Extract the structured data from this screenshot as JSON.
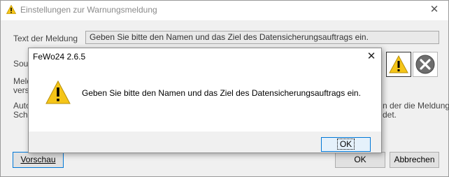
{
  "background_window": {
    "title": "Einstellungen zur Warnungsmeldung",
    "close_glyph": "✕",
    "message_label": "Text der Meldung",
    "message_value": "Geben Sie bitte den Namen und das Ziel des Datensicherungsauftrags ein.",
    "sound_label_partial": "Sour",
    "message_label2_line1": "Meld",
    "message_label2_line2": "versi",
    "auto_label_line1": "Auto",
    "auto_label_line2": "Schl",
    "right_text_line1": "n der die Meldung",
    "right_text_line2": "det.",
    "preview_button": "Vorschau",
    "ok_button_partial": "OK",
    "cancel_button": "Abbrechen",
    "icons": [
      "warning-icon",
      "error-icon"
    ]
  },
  "dialog": {
    "title": "FeWo24 2.6.5",
    "close_glyph": "✕",
    "message": "Geben Sie bitte den Namen und das Ziel des Datensicherungsauftrags ein.",
    "ok_button": "OK",
    "icon": "warning-icon"
  },
  "colors": {
    "warning_yellow": "#f5c518",
    "error_gray": "#6d6d6d",
    "focus_blue": "#0078d7"
  }
}
